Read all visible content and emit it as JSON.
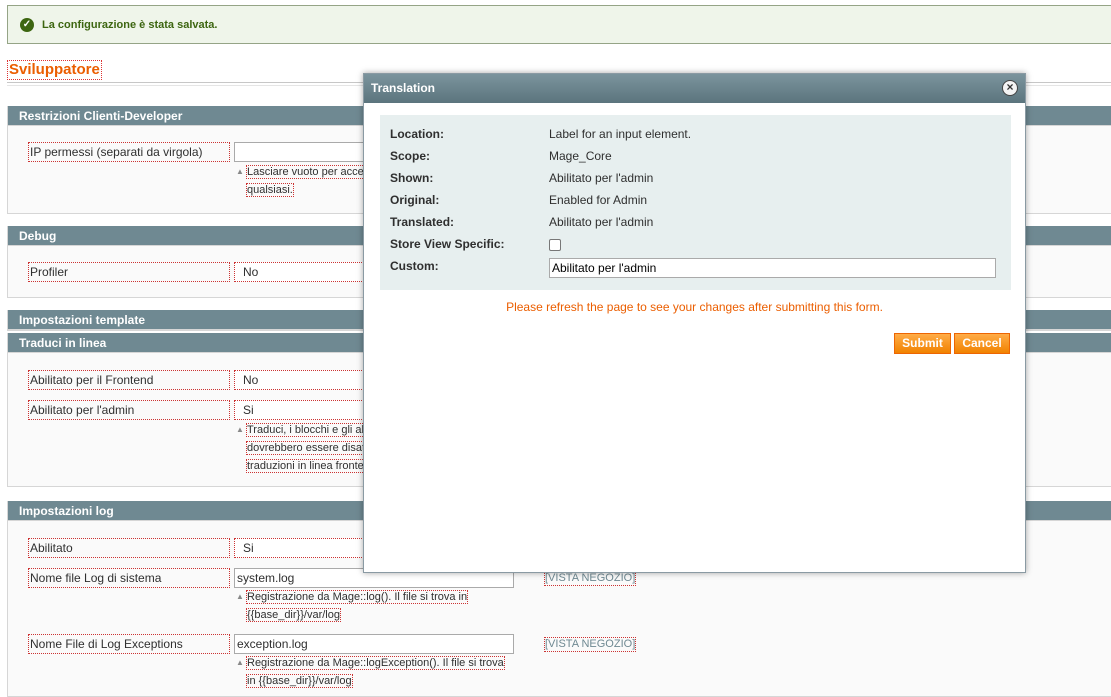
{
  "messages": {
    "success": "La configurazione è stata salvata."
  },
  "page": {
    "title": "Sviluppatore"
  },
  "sections": {
    "restrictions": {
      "title": "Restrizioni Clienti-Developer",
      "ip_label": "IP permessi (separati da virgola)",
      "ip_value": "",
      "hint_line1": "Lasciare vuoto per acce",
      "hint_line2": "qualsiasi."
    },
    "debug": {
      "title": "Debug",
      "profiler_label": "Profiler",
      "profiler_value": "No"
    },
    "template": {
      "title": "Impostazioni template"
    },
    "inline": {
      "title": "Traduci in linea",
      "frontend_label": "Abilitato per il Frontend",
      "frontend_value": "No",
      "admin_label": "Abilitato per l'admin",
      "admin_value": "Si",
      "hint_line1": "Traduci, i blocchi e gli al",
      "hint_line2": "dovrebbero essere disat",
      "hint_line3": "traduzioni in linea fronte"
    },
    "log": {
      "title": "Impostazioni log",
      "enabled_label": "Abilitato",
      "enabled_value": "Si",
      "system_label": "Nome file Log di sistema",
      "system_value": "system.log",
      "system_scope": "[VISTA NEGOZIO]",
      "system_hint1": "Registrazione da Mage::log(). Il file si trova in",
      "system_hint2": "{{base_dir}}/var/log",
      "exc_label": "Nome File di Log Exceptions",
      "exc_value": "exception.log",
      "exc_scope": "[VISTA NEGOZIO]",
      "exc_hint1": "Registrazione da Mage::logException(). Il file si trova",
      "exc_hint2": "in {{base_dir}}/var/log"
    }
  },
  "modal": {
    "title": "Translation",
    "close_glyph": "×",
    "location_key": "Location:",
    "location_value": "Label for an input element.",
    "scope_key": "Scope:",
    "scope_value": "Mage_Core",
    "shown_key": "Shown:",
    "shown_value": "Abilitato per l'admin",
    "original_key": "Original:",
    "original_value": "Enabled for Admin",
    "translated_key": "Translated:",
    "translated_value": "Abilitato per l'admin",
    "store_view_key": "Store View Specific:",
    "custom_key": "Custom:",
    "custom_value": "Abilitato per l'admin",
    "refresh_note": "Please refresh the page to see your changes after submitting this form.",
    "submit_label": "Submit",
    "cancel_label": "Cancel"
  }
}
